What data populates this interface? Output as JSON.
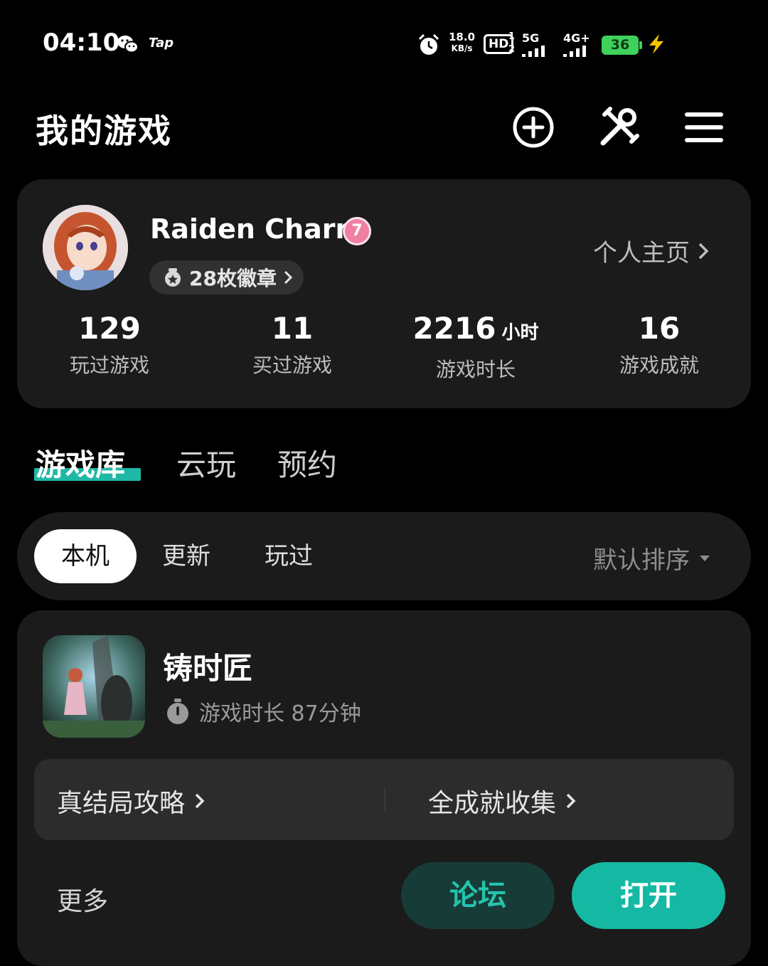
{
  "status_bar": {
    "time": "04:10",
    "tap_label": "Tap",
    "net_speed_value": "18.0",
    "net_speed_unit": "KB/s",
    "hd_label": "HD",
    "sim1": "1",
    "sim2": "2",
    "signal_5g": "5G",
    "signal_4g": "4G+",
    "battery": "36"
  },
  "header": {
    "title": "我的游戏"
  },
  "profile": {
    "username": "Raiden Charm",
    "level": "7",
    "badges": "28枚徽章",
    "homepage": "个人主页",
    "stats": [
      {
        "value": "129",
        "unit": "",
        "label": "玩过游戏"
      },
      {
        "value": "11",
        "unit": "",
        "label": "买过游戏"
      },
      {
        "value": "2216",
        "unit": "小时",
        "label": "游戏时长"
      },
      {
        "value": "16",
        "unit": "",
        "label": "游戏成就"
      }
    ]
  },
  "main_tabs": [
    "游戏库",
    "云玩",
    "预约"
  ],
  "filters": {
    "chips": [
      "本机",
      "更新",
      "玩过"
    ],
    "sort": "默认排序"
  },
  "game": {
    "name": "铸时匠",
    "playtime": "游戏时长 87分钟",
    "guide_links": [
      "真结局攻略",
      "全成就收集"
    ],
    "more": "更多",
    "forum_button": "论坛",
    "open_button": "打开"
  },
  "colors": {
    "accent": "#15b9a3",
    "card_bg": "#1b1b1b",
    "battery": "#3fd15b"
  }
}
